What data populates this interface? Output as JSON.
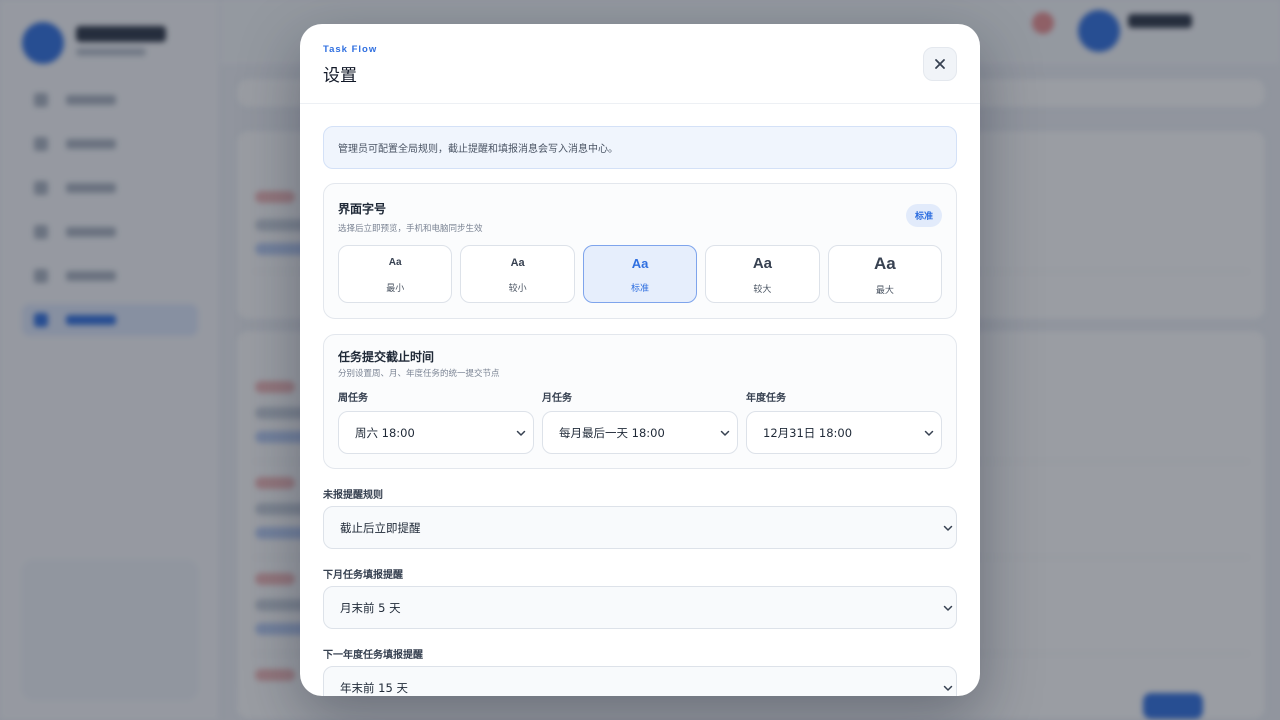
{
  "modal": {
    "kicker": "Task Flow",
    "title": "设置",
    "close_icon": "close-icon"
  },
  "notice": "管理员可配置全局规则，截止提醒和填报消息会写入消息中心。",
  "font_size": {
    "title": "界面字号",
    "subtitle": "选择后立即预览，手机和电脑同步生效",
    "current_badge": "标准",
    "options": [
      {
        "sample": "Aa",
        "label": "最小",
        "selected": false
      },
      {
        "sample": "Aa",
        "label": "较小",
        "selected": false
      },
      {
        "sample": "Aa",
        "label": "标准",
        "selected": true
      },
      {
        "sample": "Aa",
        "label": "较大",
        "selected": false
      },
      {
        "sample": "Aa",
        "label": "最大",
        "selected": false
      }
    ]
  },
  "deadline": {
    "title": "任务提交截止时间",
    "subtitle": "分别设置周、月、年度任务的统一提交节点",
    "weekly": {
      "label": "周任务",
      "value": "周六 18:00"
    },
    "monthly": {
      "label": "月任务",
      "value": "每月最后一天 18:00"
    },
    "yearly": {
      "label": "年度任务",
      "value": "12月31日 18:00"
    }
  },
  "rules": [
    {
      "label": "未报提醒规则",
      "value": "截止后立即提醒"
    },
    {
      "label": "下月任务填报提醒",
      "value": "月末前 5 天"
    },
    {
      "label": "下一年度任务填报提醒",
      "value": "年末前 15 天"
    }
  ],
  "icons": {
    "select_arrow": "chevron-down-icon"
  },
  "colors": {
    "accent": "#2f6fe0",
    "selected_bg": "#e6eefc",
    "notice_bg": "#f0f5fd"
  }
}
